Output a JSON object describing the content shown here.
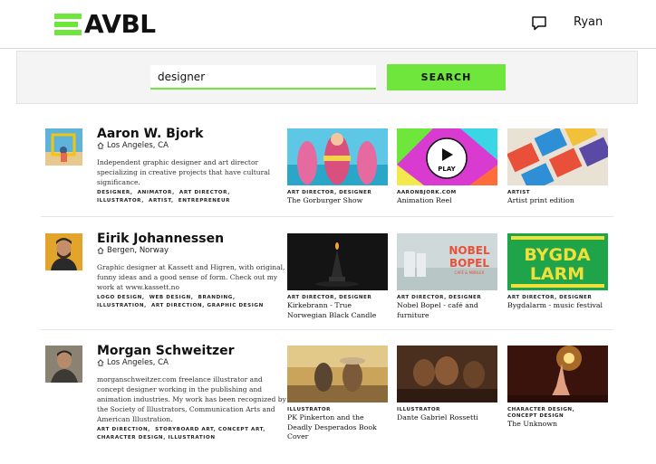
{
  "header": {
    "logo_text": "AVBL",
    "user_name": "Ryan"
  },
  "search": {
    "query": "designer",
    "button_label": "SEARCH"
  },
  "results": [
    {
      "name": "Aaron W. Bjork",
      "location": "Los Angeles, CA",
      "bio": "Independent graphic designer and art director specializing in creative projects that have cultural significance.",
      "tags": [
        "DESIGNER",
        "ANIMATOR",
        "ART DIRECTOR",
        "ILLUSTRATOR",
        "ARTIST",
        "ENTREPRENEUR"
      ],
      "projects": [
        {
          "meta": "ART DIRECTOR, DESIGNER",
          "title": "The Gorburger Show"
        },
        {
          "meta": "AARONBJORK.COM",
          "title": "Animation Reel",
          "play_label": "PLAY"
        },
        {
          "meta": "ARTIST",
          "title": "Artist print edition"
        }
      ]
    },
    {
      "name": "Eirik Johannessen",
      "location": "Bergen, Norway",
      "bio": "Graphic designer at Kassett and Higren, with original, funny ideas and a good sense of form. Check out my work at www.kassett.no",
      "tags": [
        "LOGO DESIGN",
        "WEB DESIGN",
        "BRANDING",
        "ILLUSTRATION",
        "ART DIRECTION",
        "GRAPHIC DESIGN"
      ],
      "projects": [
        {
          "meta": "ART DIRECTOR, DESIGNER",
          "title": "Kirkebrann - True Norwegian Black Candle"
        },
        {
          "meta": "ART DIRECTOR, DESIGNER",
          "title": "Nobel Bopel - café and furniture",
          "image_text": [
            "NOBEL",
            "BOPEL",
            "CAFÉ & MØBLER"
          ]
        },
        {
          "meta": "ART DIRECTOR, DESIGNER",
          "title": "Bygdalarm - music festival",
          "image_text": [
            "BYGDA",
            "LARM"
          ]
        }
      ]
    },
    {
      "name": "Morgan Schweitzer",
      "location": "Los Angeles, CA",
      "bio": "morganschweitzer.com freelance illustrator and concept designer working in the publishing and animation industries. My work has been recognized by the Society of Illustrators, Communication Arts and American Illustration.",
      "tags": [
        "ART DIRECTION",
        "STORYBOARD ART",
        "CONCEPT ART",
        "CHARACTER DESIGN",
        "ILLUSTRATION"
      ],
      "projects": [
        {
          "meta": "ILLUSTRATOR",
          "title": "PK Pinkerton and the Deadly Desperados Book Cover"
        },
        {
          "meta": "ILLUSTRATOR",
          "title": "Dante Gabriel Rossetti"
        },
        {
          "meta": "CHARACTER DESIGN, CONCEPT DESIGN",
          "title": "The Unknown"
        }
      ]
    }
  ],
  "colors": {
    "accent": "#6fe63c",
    "search_band": "#f4f4f4",
    "divider": "#e4e4e4"
  },
  "icons": {
    "logo": "stacked-bars-logo-icon",
    "messages": "speech-bubble-icon",
    "location": "home-icon",
    "play": "play-icon"
  }
}
